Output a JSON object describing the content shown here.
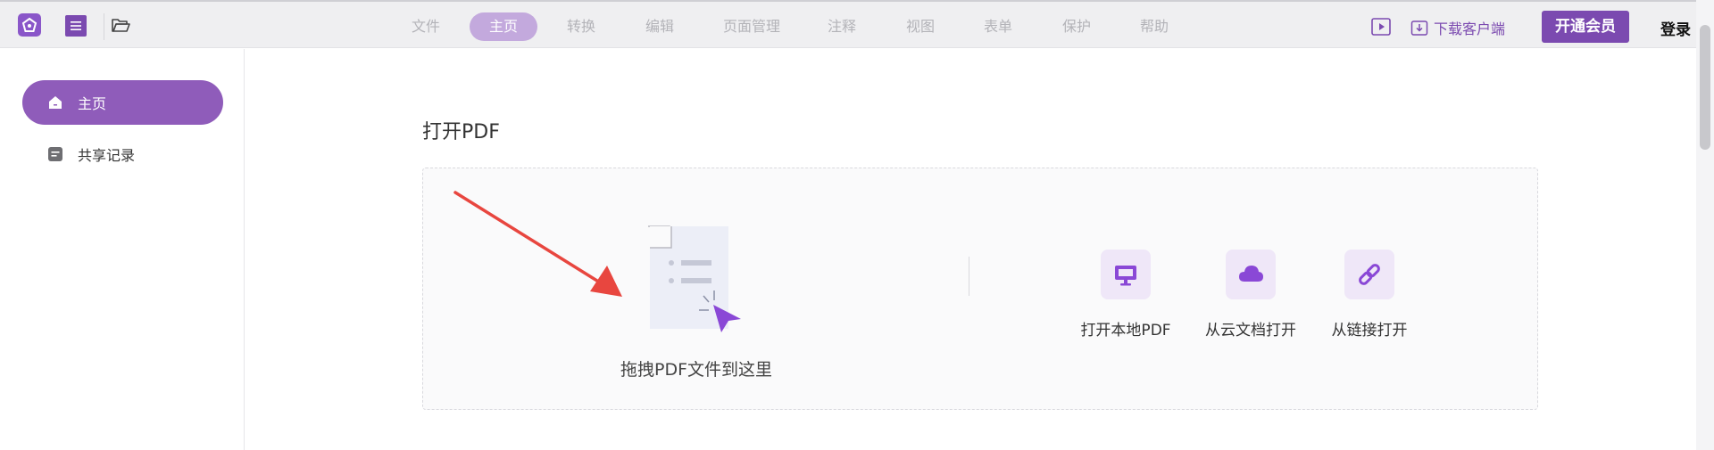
{
  "toolbar": {
    "nav": [
      "文件",
      "主页",
      "转换",
      "编辑",
      "页面管理",
      "注释",
      "视图",
      "表单",
      "保护",
      "帮助"
    ],
    "active_nav": "主页",
    "download_label": "下载客户端",
    "vip_label": "开通会员",
    "login_label": "登录"
  },
  "sidebar": {
    "items": [
      {
        "label": "主页",
        "icon": "home-icon",
        "active": true
      },
      {
        "label": "共享记录",
        "icon": "document-icon",
        "active": false
      }
    ]
  },
  "main": {
    "title": "打开PDF",
    "drag_text": "拖拽PDF文件到这里",
    "actions": [
      {
        "label": "打开本地PDF",
        "icon": "monitor-icon"
      },
      {
        "label": "从云文档打开",
        "icon": "cloud-icon"
      },
      {
        "label": "从链接打开",
        "icon": "link-icon"
      }
    ]
  },
  "colors": {
    "accent": "#7b4ab0",
    "sidebar_active": "#8f5cba",
    "nav_active": "#c3a9dd",
    "annotation_arrow": "#e8463f"
  }
}
